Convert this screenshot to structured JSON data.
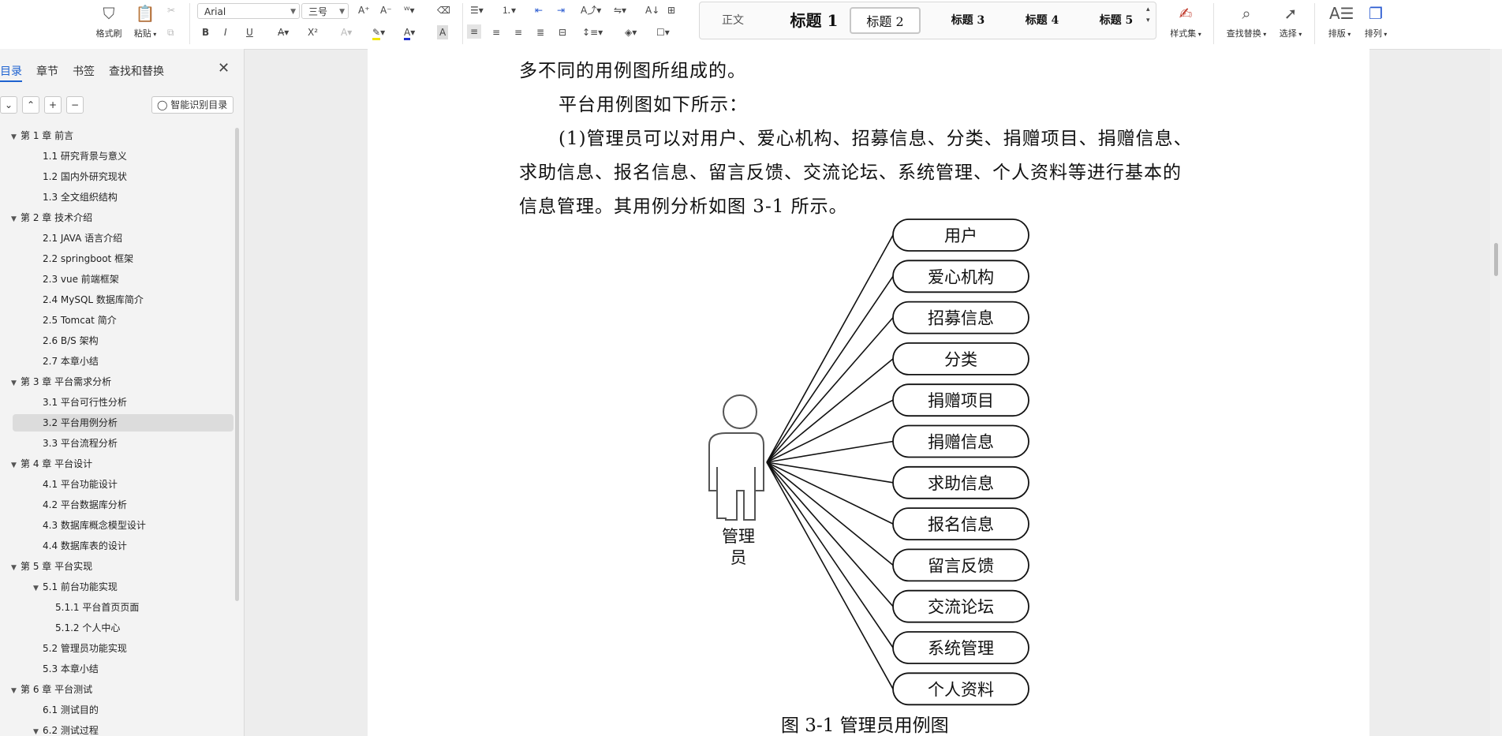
{
  "ribbon": {
    "format_painter": "格式刷",
    "paste": "粘贴",
    "font_name": "Arial",
    "font_size": "三号",
    "styles": [
      "正文",
      "标题 1",
      "标题 2",
      "标题 3",
      "标题 4",
      "标题 5"
    ],
    "selected_style": "标题 2",
    "style_set": "样式集",
    "find_replace": "查找替换",
    "select": "选择",
    "layout": "排版",
    "arrange": "排列",
    "bold": "B",
    "italic": "I",
    "underline": "U",
    "superscript": "X²",
    "font_color_letter": "A"
  },
  "sidebar": {
    "tabs": [
      "目录",
      "章节",
      "书签",
      "查找和替换"
    ],
    "active_tab": "目录",
    "smart_toc": "智能识别目录",
    "toc": [
      {
        "label": "第 1 章  前言",
        "level": 0,
        "expanded": true
      },
      {
        "label": "1.1 研究背景与意义",
        "level": 1
      },
      {
        "label": "1.2 国内外研究现状",
        "level": 1
      },
      {
        "label": "1.3 全文组织结构",
        "level": 1
      },
      {
        "label": "第 2 章  技术介绍",
        "level": 0,
        "expanded": true
      },
      {
        "label": "2.1 JAVA 语言介绍",
        "level": 1
      },
      {
        "label": "2.2 springboot 框架",
        "level": 1
      },
      {
        "label": "2.3 vue 前端框架",
        "level": 1
      },
      {
        "label": "2.4 MySQL 数据库简介",
        "level": 1
      },
      {
        "label": "2.5 Tomcat 简介",
        "level": 1
      },
      {
        "label": "2.6 B/S 架构",
        "level": 1
      },
      {
        "label": "2.7 本章小结",
        "level": 1
      },
      {
        "label": "第 3 章  平台需求分析",
        "level": 0,
        "expanded": true
      },
      {
        "label": "3.1 平台可行性分析",
        "level": 1
      },
      {
        "label": "3.2 平台用例分析",
        "level": 1,
        "selected": true
      },
      {
        "label": "3.3 平台流程分析",
        "level": 1
      },
      {
        "label": "第 4 章  平台设计",
        "level": 0,
        "expanded": true
      },
      {
        "label": "4.1 平台功能设计",
        "level": 1
      },
      {
        "label": "4.2 平台数据库分析",
        "level": 1
      },
      {
        "label": "4.3 数据库概念模型设计",
        "level": 1
      },
      {
        "label": "4.4 数据库表的设计",
        "level": 1
      },
      {
        "label": "第 5 章  平台实现",
        "level": 0,
        "expanded": true
      },
      {
        "label": "5.1 前台功能实现",
        "level": 1,
        "expanded": true
      },
      {
        "label": "5.1.1 平台首页页面",
        "level": 2
      },
      {
        "label": "5.1.2 个人中心",
        "level": 2
      },
      {
        "label": "5.2 管理员功能实现",
        "level": 1
      },
      {
        "label": "5.3 本章小结",
        "level": 1
      },
      {
        "label": "第 6 章  平台测试",
        "level": 0,
        "expanded": true
      },
      {
        "label": "6.1 测试目的",
        "level": 1
      },
      {
        "label": "6.2 测试过程",
        "level": 1,
        "expanded": true
      }
    ]
  },
  "document": {
    "line1": "多不同的用例图所组成的。",
    "line2": "平台用例图如下所示：",
    "line3": "(1)管理员可以对用户、爱心机构、招募信息、分类、捐赠项目、捐赠信息、",
    "line4": "求助信息、报名信息、留言反馈、交流论坛、系统管理、个人资料等进行基本的",
    "line5": "信息管理。其用例分析如图 3-1 所示。",
    "actor_line1": "管理",
    "actor_line2": "员",
    "use_cases": [
      "用户",
      "爱心机构",
      "招募信息",
      "分类",
      "捐赠项目",
      "捐赠信息",
      "求助信息",
      "报名信息",
      "留言反馈",
      "交流论坛",
      "系统管理",
      "个人资料"
    ],
    "caption": "图 3-1 管理员用例图"
  }
}
